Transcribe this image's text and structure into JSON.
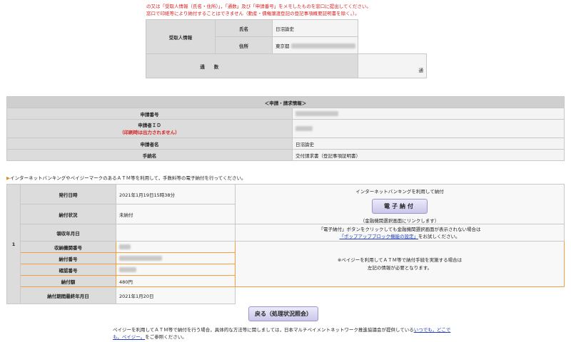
{
  "notes": {
    "line1": "の又は「受取人情報（氏名・住所）」，「通数」及び「申請番号」をメモしたものを窓口に提出してください。",
    "line2": "窓口で印紙等により納付することはできません（動産・債権譲渡登記の登記事項概要証明書を除く。）。"
  },
  "recipient": {
    "section_label": "受取人情報",
    "name_label": "氏名",
    "name_value": "日沼論史",
    "address_label": "住所",
    "address_value": "東京都",
    "copies_label": "通　　数",
    "copies_unit": "通"
  },
  "request": {
    "title": "＜申請・請求情報＞",
    "rows": [
      {
        "label": "申請番号",
        "value": ""
      },
      {
        "label": "申請者ＩＤ",
        "note": "（印刷時は出力されません）",
        "value": ""
      },
      {
        "label": "申請者名",
        "value": "日沼論史"
      },
      {
        "label": "手続名",
        "value": "交付請求書（登記事項証明書）"
      }
    ]
  },
  "info_line": "インターネットバンキングやペイジーマークのあるＡＴＭ等を利用して，手数料等の電子納付を行ってください。",
  "payment": {
    "row_number": "1",
    "issue_datetime_label": "発行日時",
    "issue_datetime_value": "2021年1月19日15時38分",
    "status_label": "納付状況",
    "status_value": "未納付",
    "receipt_date_label": "領収年月日",
    "receipt_date_value": "",
    "agency_no_label": "収納機関番号",
    "payment_no_label": "納付番号",
    "confirm_no_label": "確認番号",
    "amount_label": "納付額",
    "amount_value": "480円",
    "deadline_label": "納付期間最終年月日",
    "deadline_value": "2021年1月20日",
    "netbank_heading": "インターネットバンキングを利用して納付",
    "epay_button": "電子納付",
    "epay_note": "（金融機関選択画面にリンクします）",
    "popup_note1": "「電子納付」ボタンをクリックしても金融機関選択画面が表示されない場合は",
    "popup_link": "「ポップアップブロック機能の設定」",
    "popup_note2": "をお試しください。",
    "atm_note1": "※ペイジーを利用してＡＴＭ等で納付手続を実施する場合は",
    "atm_note2": "左記の情報が必要となります。"
  },
  "back_button": "戻る（処理状況照会）",
  "footer": {
    "text1": "ペイジーを利用してＡＴＭ等で納付を行う場合，具体的な方法等に関しましては，日本マルチペイメントネットワーク推進協議会が提供している",
    "link": "いつでも，どこでも，ペイジー。",
    "text2": "をご参照ください。"
  }
}
